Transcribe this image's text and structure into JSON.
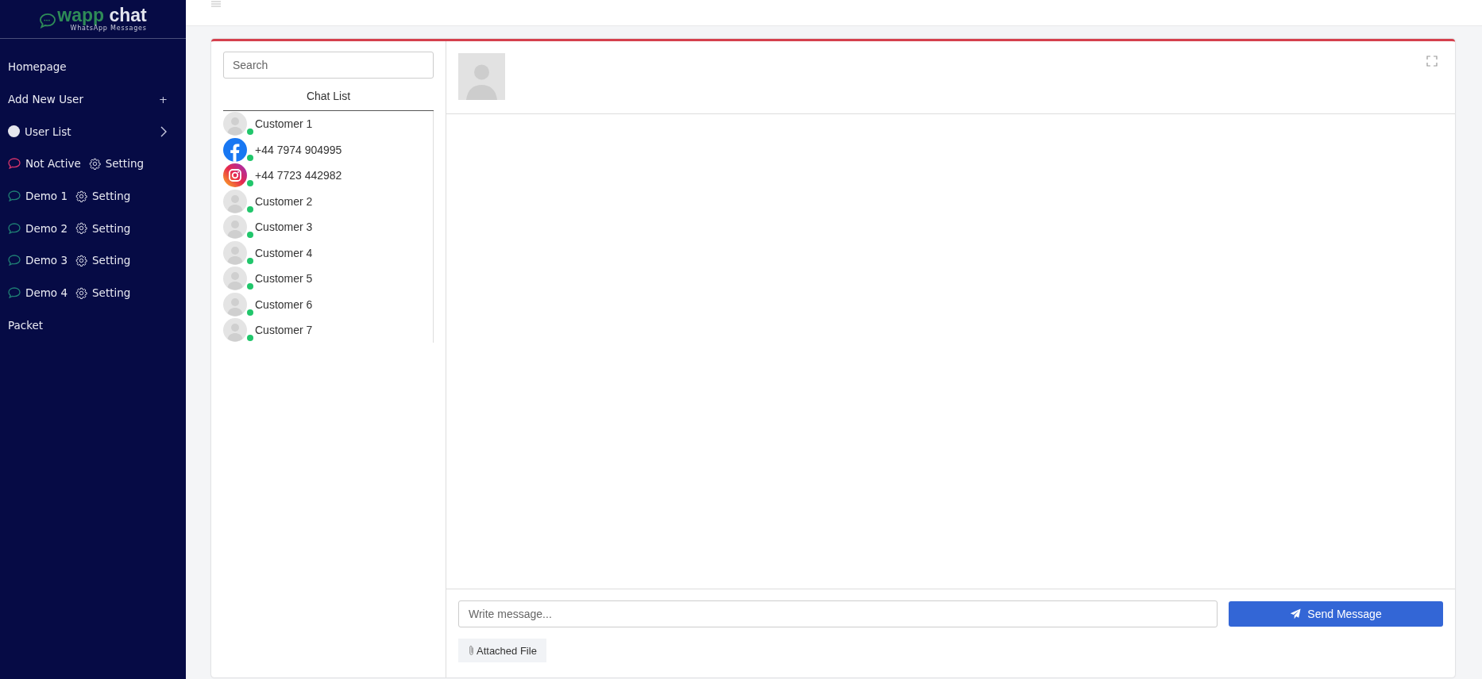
{
  "logo": {
    "brand_prefix": "wapp",
    "brand_suffix": "chat",
    "tagline": "WhatsApp Messages"
  },
  "sidebar": {
    "items": [
      {
        "kind": "link",
        "label": "Homepage"
      },
      {
        "kind": "add",
        "label": "Add New User",
        "icon_text": "+"
      },
      {
        "kind": "expand",
        "label": "User List"
      },
      {
        "kind": "channel",
        "label": "Not Active",
        "color": "#d8346a",
        "setting": "Setting"
      },
      {
        "kind": "channel",
        "label": "Demo 1",
        "color": "#1f7f74",
        "setting": "Setting"
      },
      {
        "kind": "channel",
        "label": "Demo 2",
        "color": "#1f7f74",
        "setting": "Setting"
      },
      {
        "kind": "channel",
        "label": "Demo 3",
        "color": "#1f7f74",
        "setting": "Setting"
      },
      {
        "kind": "channel",
        "label": "Demo 4",
        "color": "#1f7f74",
        "setting": "Setting"
      },
      {
        "kind": "link",
        "label": "Packet"
      }
    ]
  },
  "chat_panel": {
    "search": {
      "placeholder": "Search"
    },
    "title": "Chat List",
    "chats": [
      {
        "name": "Customer 1",
        "kind": "avatar",
        "online": true
      },
      {
        "name": "+44 7974 904995",
        "kind": "facebook",
        "online": true
      },
      {
        "name": "+44 7723 442982",
        "kind": "instagram",
        "online": true
      },
      {
        "name": "Customer 2",
        "kind": "avatar",
        "online": true
      },
      {
        "name": "Customer 3",
        "kind": "avatar",
        "online": true
      },
      {
        "name": "Customer 4",
        "kind": "avatar",
        "online": true
      },
      {
        "name": "Customer 5",
        "kind": "avatar",
        "online": true
      },
      {
        "name": "Customer 6",
        "kind": "avatar",
        "online": true
      },
      {
        "name": "Customer 7",
        "kind": "avatar",
        "online": true
      }
    ]
  },
  "composer": {
    "placeholder": "Write message...",
    "send_label": "Send Message",
    "attach_label": "Attached File"
  }
}
